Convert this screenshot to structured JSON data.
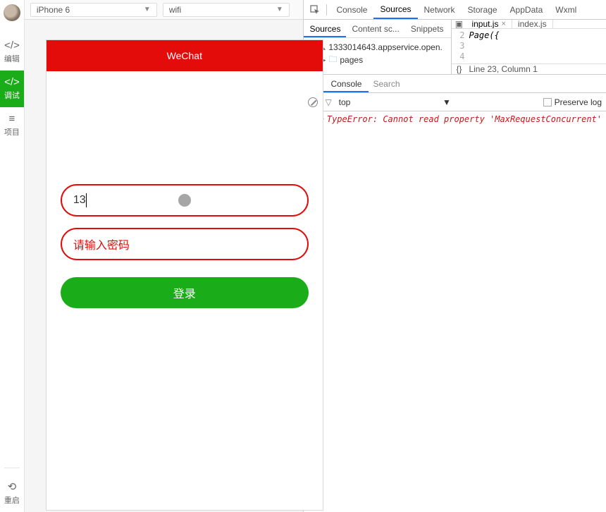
{
  "rail": {
    "edit_label": "编辑",
    "debug_label": "调试",
    "project_label": "项目",
    "restart_label": "重启",
    "code_icon": "</>",
    "debug_icon": "</>",
    "menu_icon": "≡",
    "restart_icon": "⟲"
  },
  "sim": {
    "device": "iPhone 6",
    "network": "wifi",
    "header_title": "WeChat",
    "username_value": "13",
    "password_placeholder": "请输入密码",
    "login_label": "登录"
  },
  "dev": {
    "tabs": {
      "console": "Console",
      "sources": "Sources",
      "network": "Network",
      "storage": "Storage",
      "appdata": "AppData",
      "wxml": "Wxml"
    },
    "src_tabs": {
      "sources": "Sources",
      "content": "Content sc...",
      "snippets": "Snippets"
    },
    "tree": {
      "host": "1333014643.appservice.open.",
      "pages": "pages"
    },
    "files": {
      "input": "input.js",
      "index": "index.js"
    },
    "code": {
      "l2": "2",
      "l3": "3",
      "l4": "4",
      "line2": "Page({"
    },
    "status": "Line 23, Column 1",
    "bracket": "{}",
    "console_tab": "Console",
    "search_label": "Search",
    "top_label": "top",
    "preserve_label": "Preserve log",
    "error_msg": "TypeError: Cannot read property 'MaxRequestConcurrent'"
  }
}
